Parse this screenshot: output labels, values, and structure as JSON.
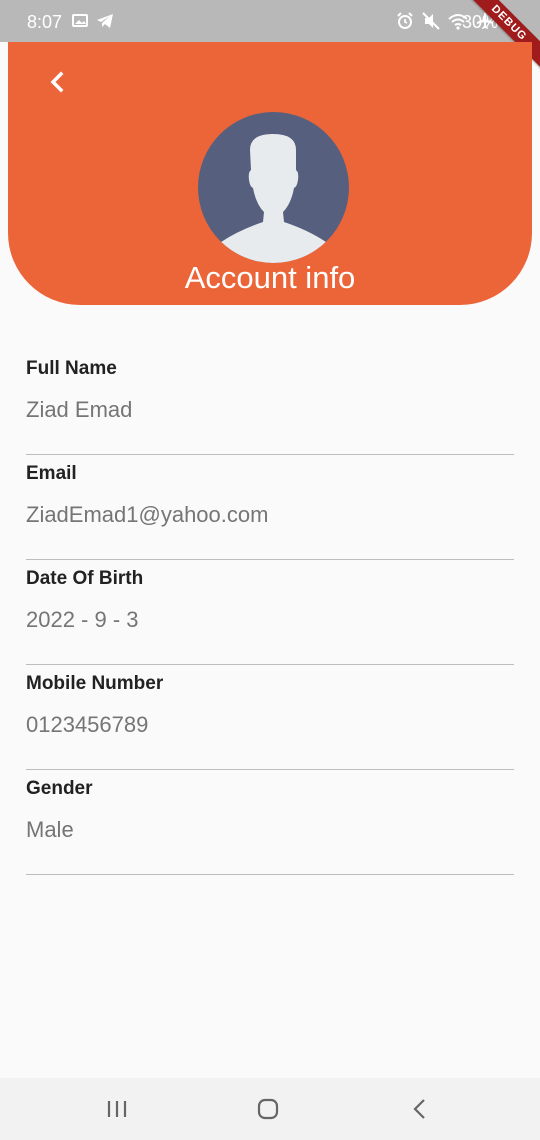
{
  "status_bar": {
    "time": "8:07",
    "battery": "30%",
    "debug_banner": "DEBUG",
    "icons": [
      "gallery-icon",
      "telegram-icon",
      "alarm-icon",
      "mute-icon",
      "wifi-icon",
      "airplane-icon"
    ]
  },
  "header": {
    "title": "Account info",
    "back_icon": "chevron-left-icon",
    "avatar_icon": "person-silhouette-icon",
    "background_color": "#ec6538",
    "avatar_color": "#56607e"
  },
  "fields": [
    {
      "label": "Full Name",
      "value": "Ziad Emad"
    },
    {
      "label": "Email",
      "value": "ZiadEmad1@yahoo.com"
    },
    {
      "label": "Date Of Birth",
      "value": "2022 - 9 - 3"
    },
    {
      "label": "Mobile Number",
      "value": "0123456789"
    },
    {
      "label": "Gender",
      "value": "Male"
    }
  ],
  "nav_bar": {
    "buttons": [
      "recent-apps-icon",
      "home-icon",
      "back-icon"
    ]
  }
}
